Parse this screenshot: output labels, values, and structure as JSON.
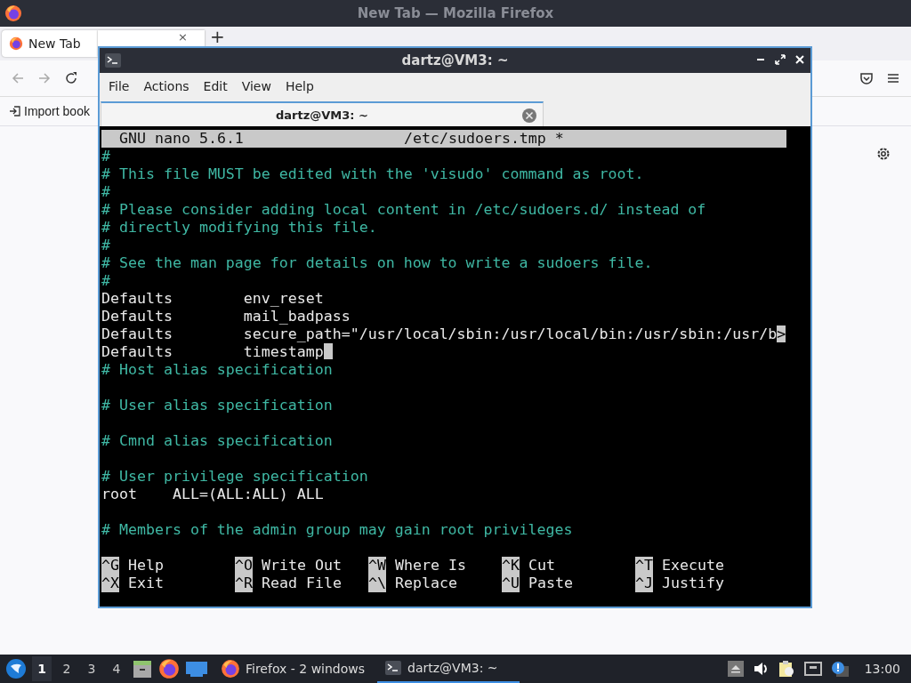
{
  "firefox": {
    "title": "New Tab — Mozilla Firefox",
    "tabs": [
      {
        "label": "New Tab",
        "selected": true,
        "close": "×"
      }
    ],
    "new_tab": "+",
    "bookmarks": [
      {
        "label": "Import book"
      }
    ]
  },
  "terminal": {
    "title": "dartz@VM3: ~",
    "menu": [
      "File",
      "Actions",
      "Edit",
      "View",
      "Help"
    ],
    "tabs": [
      {
        "label": "dartz@VM3: ~",
        "selected": true
      }
    ],
    "nano": {
      "version": "GNU nano 5.6.1",
      "filename": "/etc/sudoers.tmp *",
      "lines": [
        {
          "kind": "comment",
          "text": "#"
        },
        {
          "kind": "comment",
          "text": "# This file MUST be edited with the 'visudo' command as root."
        },
        {
          "kind": "comment",
          "text": "#"
        },
        {
          "kind": "comment",
          "text": "# Please consider adding local content in /etc/sudoers.d/ instead of"
        },
        {
          "kind": "comment",
          "text": "# directly modifying this file."
        },
        {
          "kind": "comment",
          "text": "#"
        },
        {
          "kind": "comment",
          "text": "# See the man page for details on how to write a sudoers file."
        },
        {
          "kind": "comment",
          "text": "#"
        },
        {
          "kind": "plain",
          "text": "Defaults        env_reset"
        },
        {
          "kind": "plain",
          "text": "Defaults        mail_badpass"
        },
        {
          "kind": "plain",
          "text": "Defaults        secure_path=\"/usr/local/sbin:/usr/local/bin:/usr/sbin:/usr/b",
          "marker": ">"
        },
        {
          "kind": "plain",
          "text": "Defaults        timestamp",
          "cursor": true
        },
        {
          "kind": "comment",
          "text": "# Host alias specification"
        },
        {
          "kind": "blank"
        },
        {
          "kind": "comment",
          "text": "# User alias specification"
        },
        {
          "kind": "blank"
        },
        {
          "kind": "comment",
          "text": "# Cmnd alias specification"
        },
        {
          "kind": "blank"
        },
        {
          "kind": "comment",
          "text": "# User privilege specification"
        },
        {
          "kind": "plain",
          "text": "root    ALL=(ALL:ALL) ALL"
        },
        {
          "kind": "blank"
        },
        {
          "kind": "comment",
          "text": "# Members of the admin group may gain root privileges"
        },
        {
          "kind": "blank"
        }
      ],
      "shortcuts": [
        [
          {
            "key": "^G",
            "label": "Help"
          },
          {
            "key": "^O",
            "label": "Write Out"
          },
          {
            "key": "^W",
            "label": "Where Is"
          },
          {
            "key": "^K",
            "label": "Cut"
          },
          {
            "key": "^T",
            "label": "Execute"
          }
        ],
        [
          {
            "key": "^X",
            "label": "Exit"
          },
          {
            "key": "^R",
            "label": "Read File"
          },
          {
            "key": "^\\",
            "label": "Replace"
          },
          {
            "key": "^U",
            "label": "Paste"
          },
          {
            "key": "^J",
            "label": "Justify"
          }
        ]
      ]
    }
  },
  "taskbar": {
    "workspaces": [
      {
        "label": "1",
        "selected": true
      },
      {
        "label": "2",
        "selected": false
      },
      {
        "label": "3",
        "selected": false
      },
      {
        "label": "4",
        "selected": false
      }
    ],
    "tasks": [
      {
        "kind": "firefox",
        "label": "Firefox - 2 windows",
        "selected": false
      },
      {
        "kind": "terminal",
        "label": "dartz@VM3: ~",
        "selected": true
      }
    ],
    "clock": "13:00"
  }
}
